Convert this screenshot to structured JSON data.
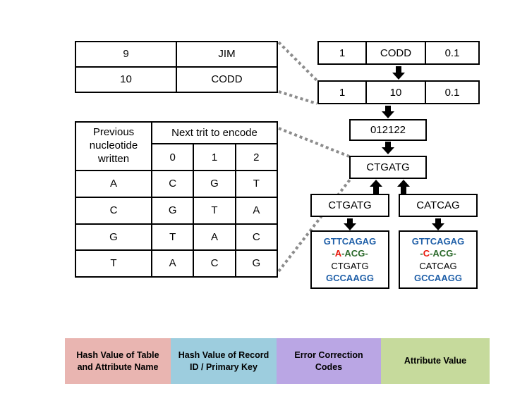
{
  "record_table": {
    "rows": [
      {
        "id": "9",
        "name": "JIM"
      },
      {
        "id": "10",
        "name": "CODD"
      }
    ]
  },
  "trit_table": {
    "header_prev": "Previous nucleotide written",
    "header_next": "Next trit to encode",
    "trits": [
      "0",
      "1",
      "2"
    ],
    "rows": [
      {
        "prev": "A",
        "c0": "C",
        "c1": "G",
        "c2": "T"
      },
      {
        "prev": "C",
        "c0": "G",
        "c1": "T",
        "c2": "A"
      },
      {
        "prev": "G",
        "c0": "T",
        "c1": "A",
        "c2": "C"
      },
      {
        "prev": "T",
        "c0": "A",
        "c1": "C",
        "c2": "G"
      }
    ]
  },
  "pipeline": {
    "row_codd": {
      "table_hash": "1",
      "record_key": "CODD",
      "ecc": "0.1"
    },
    "row_ten": {
      "table_hash": "1",
      "record_key": "10",
      "ecc": "0.1"
    },
    "trits": "012122",
    "nucleotides": "CTGATG",
    "strand_forward": "CTGATG",
    "strand_reverse": "CATCAG",
    "dna_left": {
      "ecc_top": "GTTCAGAG",
      "mid_prefix": "-",
      "mid_hash1": "A",
      "mid_sep1": "-",
      "mid_hash2": "ACG",
      "mid_suffix": "-",
      "value": "CTGATG",
      "ecc_bottom": "GCCAAGG"
    },
    "dna_right": {
      "ecc_top": "GTTCAGAG",
      "mid_prefix": "-",
      "mid_hash1": "C",
      "mid_sep1": "-",
      "mid_hash2": "ACG",
      "mid_suffix": "-",
      "value": "CATCAG",
      "ecc_bottom": "GCCAAGG"
    }
  },
  "legend": {
    "items": [
      {
        "label": "Hash Value of Table and Attribute Name",
        "color": "#e9b5b1"
      },
      {
        "label": "Hash Value of Record ID / Primary Key",
        "color": "#9dcdde"
      },
      {
        "label": "Error Correction Codes",
        "color": "#baa6e4"
      },
      {
        "label": "Attribute Value",
        "color": "#c6da9c"
      }
    ]
  },
  "colors": {
    "ecc_blue": "#1f5fa8",
    "hash_red": "#e8190c",
    "hash_green": "#2b6a2b",
    "connector_gray": "#8c8c8c",
    "ink": "#000000"
  }
}
